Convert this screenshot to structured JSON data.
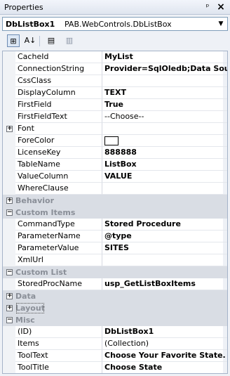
{
  "window": {
    "title": "Properties",
    "pin_glyph": "ᵖ",
    "close_glyph": "×"
  },
  "selector": {
    "name": "DbListBox1",
    "type": "PAB.WebControls.DbListBox",
    "drop_glyph": "▼"
  },
  "toolbar": {
    "b1": "⊞",
    "b2": "A↓",
    "b3": "▤",
    "b4": "▥"
  },
  "properties": [
    {
      "kind": "prop",
      "name": "CacheId",
      "value": "MyList",
      "bold": true
    },
    {
      "kind": "prop",
      "name": "ConnectionString",
      "value": "Provider=SqlOledb;Data Sou",
      "bold": true
    },
    {
      "kind": "prop",
      "name": "CssClass",
      "value": "",
      "bold": false
    },
    {
      "kind": "prop",
      "name": "DisplayColumn",
      "value": "TEXT",
      "bold": true
    },
    {
      "kind": "prop",
      "name": "FirstField",
      "value": "True",
      "bold": true
    },
    {
      "kind": "prop",
      "name": "FirstFieldText",
      "value": "--Choose--",
      "bold": false
    },
    {
      "kind": "prop",
      "name": "Font",
      "value": "",
      "bold": false,
      "expander": "+"
    },
    {
      "kind": "prop",
      "name": "ForeColor",
      "value": "",
      "bold": false,
      "swatch": true
    },
    {
      "kind": "prop",
      "name": "LicenseKey",
      "value": "888888",
      "bold": true
    },
    {
      "kind": "prop",
      "name": "TableName",
      "value": "ListBox",
      "bold": true
    },
    {
      "kind": "prop",
      "name": "ValueColumn",
      "value": "VALUE",
      "bold": true
    },
    {
      "kind": "prop",
      "name": "WhereClause",
      "value": "",
      "bold": false
    },
    {
      "kind": "cat",
      "name": "Behavior",
      "expander": "+"
    },
    {
      "kind": "cat",
      "name": "Custom Items",
      "expander": "−"
    },
    {
      "kind": "prop",
      "name": "CommandType",
      "value": "Stored Procedure",
      "bold": true
    },
    {
      "kind": "prop",
      "name": "ParameterName",
      "value": "@type",
      "bold": true
    },
    {
      "kind": "prop",
      "name": "ParameterValue",
      "value": "SITES",
      "bold": true
    },
    {
      "kind": "prop",
      "name": "XmlUrl",
      "value": "",
      "bold": false
    },
    {
      "kind": "cat",
      "name": "Custom List",
      "expander": "−"
    },
    {
      "kind": "prop",
      "name": "StoredProcName",
      "value": "usp_GetListBoxItems",
      "bold": true
    },
    {
      "kind": "cat",
      "name": "Data",
      "expander": "+"
    },
    {
      "kind": "cat",
      "name": "Layout",
      "expander": "+",
      "focused": true
    },
    {
      "kind": "cat",
      "name": "Misc",
      "expander": "−"
    },
    {
      "kind": "prop",
      "name": "(ID)",
      "value": "DbListBox1",
      "bold": true
    },
    {
      "kind": "prop",
      "name": "Items",
      "value": "(Collection)",
      "bold": false
    },
    {
      "kind": "prop",
      "name": "ToolText",
      "value": "Choose Your Favorite State.",
      "bold": true
    },
    {
      "kind": "prop",
      "name": "ToolTitle",
      "value": "Choose State",
      "bold": true
    }
  ]
}
